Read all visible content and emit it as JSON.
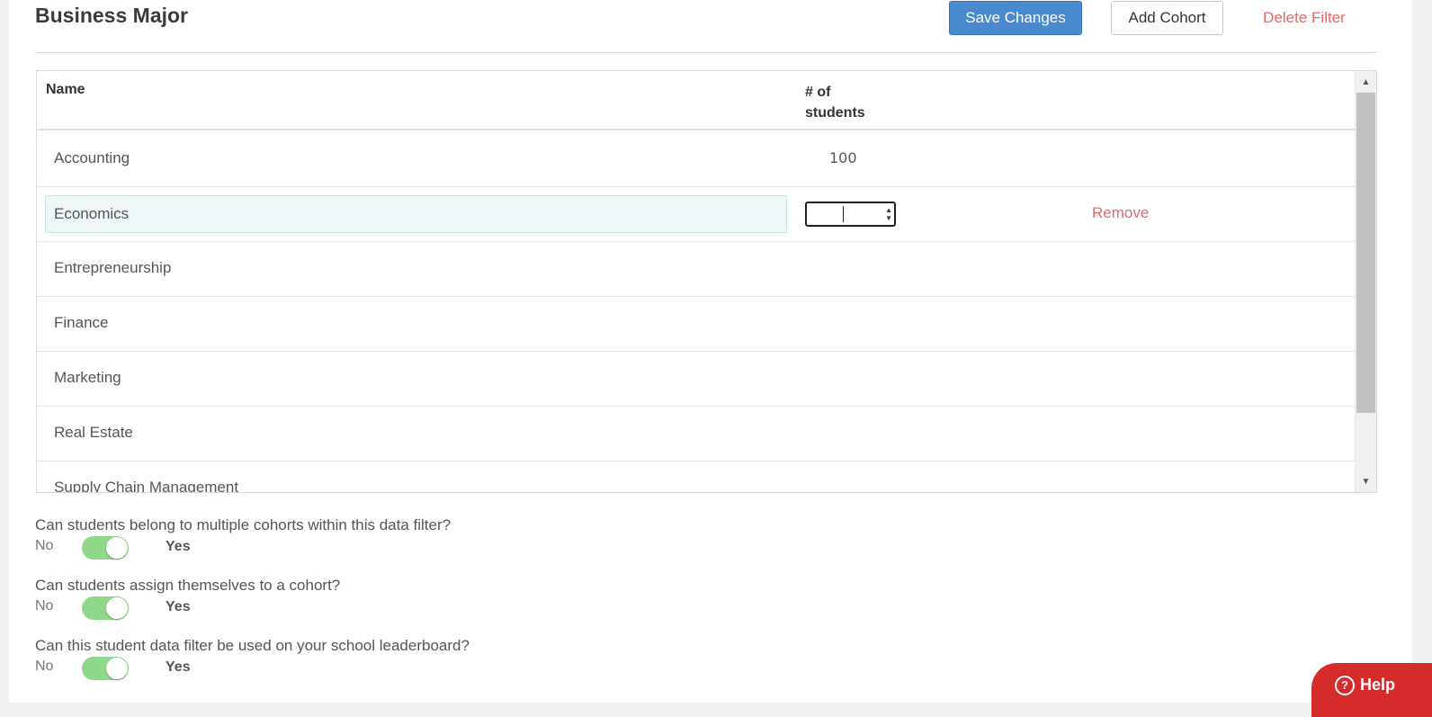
{
  "header": {
    "title": "Business Major",
    "save_label": "Save Changes",
    "add_label": "Add Cohort",
    "delete_label": "Delete Filter"
  },
  "table": {
    "col_name": "Name",
    "col_num": "# of\nstudents",
    "rows": [
      {
        "name": "Accounting",
        "students": "100"
      },
      {
        "name": "Economics",
        "students": "",
        "editing": true,
        "remove_label": "Remove"
      },
      {
        "name": "Entrepreneurship",
        "students": ""
      },
      {
        "name": "Finance",
        "students": ""
      },
      {
        "name": "Marketing",
        "students": ""
      },
      {
        "name": "Real Estate",
        "students": ""
      },
      {
        "name": "Supply Chain Management",
        "students": ""
      }
    ]
  },
  "settings": [
    {
      "question": "Can students belong to multiple cohorts within this data filter?",
      "no_label": "No",
      "yes_label": "Yes",
      "value": "Yes"
    },
    {
      "question": "Can students assign themselves to a cohort?",
      "no_label": "No",
      "yes_label": "Yes",
      "value": "Yes"
    },
    {
      "question": "Can this student data filter be used on your school leaderboard?",
      "no_label": "No",
      "yes_label": "Yes",
      "value": "Yes"
    }
  ],
  "help": {
    "label": "Help"
  },
  "colors": {
    "primary": "#4a89d0",
    "danger": "#e06a6a",
    "toggle_on": "#8fd88a",
    "help": "#d62b2b"
  }
}
